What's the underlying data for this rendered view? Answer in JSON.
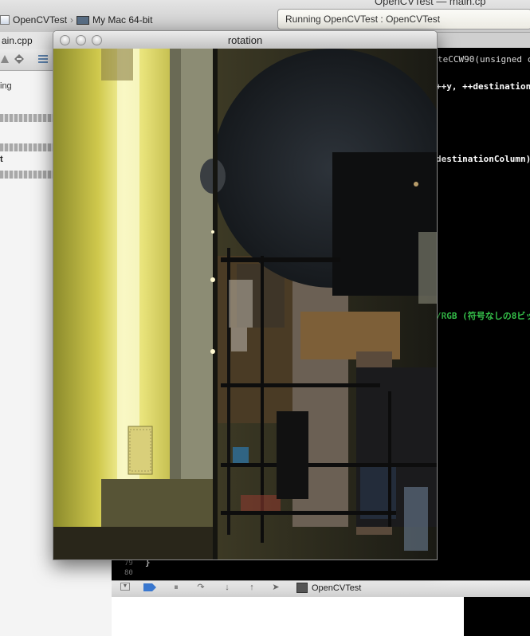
{
  "xcode": {
    "title_strip": "OpenCVTest — main.cp",
    "scheme": "OpenCVTest",
    "destination": "My Mac 64-bit",
    "activity": "Running OpenCVTest : OpenCVTest",
    "nav_tab": "ain.cpp",
    "nav_text_ing": "ing",
    "nav_text_t": "t"
  },
  "code": {
    "line1": "teCCW90(unsigned ch",
    "line2": "++y, ++destination",
    "line3": "destinationColumn)",
    "line4": "/RGB (符号なしの8ビッ",
    "closing_brace": "}",
    "line_numbers": [
      "79",
      "80"
    ]
  },
  "debug": {
    "target": "OpenCVTest"
  },
  "window": {
    "title": "rotation"
  },
  "icons": {
    "project": "xcode-project-icon",
    "mac": "mac-computer-icon",
    "close": "close-light-icon",
    "minimize": "minimize-light-icon",
    "zoom": "zoom-light-icon"
  }
}
